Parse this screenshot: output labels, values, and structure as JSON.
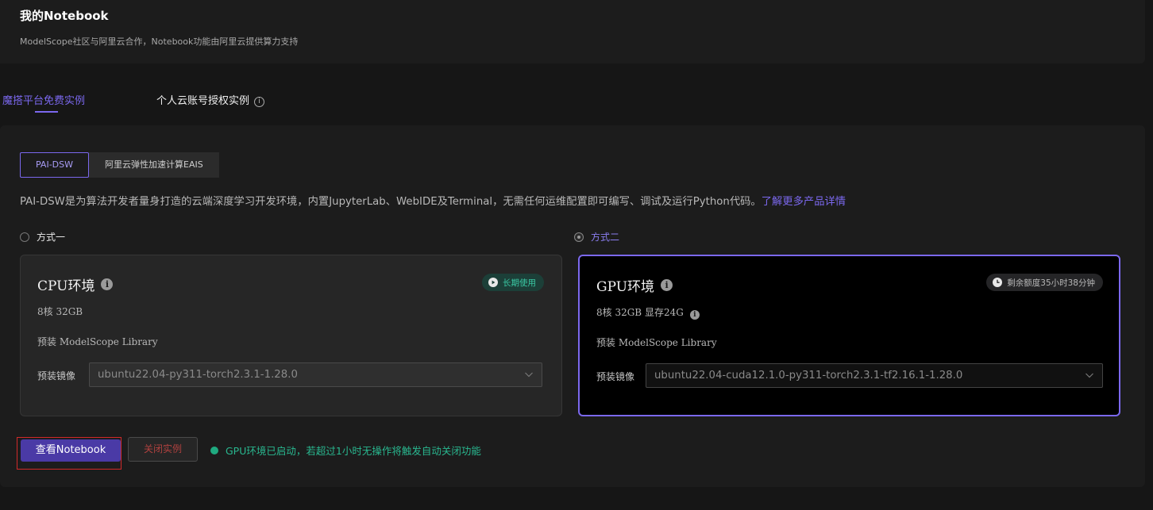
{
  "header": {
    "title": "我的Notebook",
    "subtitle": "ModelScope社区与阿里云合作，Notebook功能由阿里云提供算力支持"
  },
  "tabs": [
    {
      "label": "魔搭平台免费实例",
      "active": true
    },
    {
      "label": "个人云账号授权实例",
      "active": false,
      "icon": "info-circle-icon"
    }
  ],
  "segmented": [
    {
      "label": "PAI-DSW",
      "active": true
    },
    {
      "label": "阿里云弹性加速计算EAIS",
      "active": false
    }
  ],
  "description": {
    "text": "PAI-DSW是为算法开发者量身打造的云端深度学习开发环境，内置JupyterLab、WebIDE及Terminal，无需任何运维配置即可编写、调试及运行Python代码。",
    "link": "了解更多产品详情"
  },
  "options": [
    {
      "radio_label": "方式一",
      "selected": false,
      "title": "CPU环境",
      "badge": "长期使用",
      "spec": "8核 32GB",
      "library": "预装 ModelScope Library",
      "image_label": "预装镜像",
      "image_value": "ubuntu22.04-py311-torch2.3.1-1.28.0"
    },
    {
      "radio_label": "方式二",
      "selected": true,
      "title": "GPU环境",
      "badge": "剩余额度35小时38分钟",
      "spec": "8核 32GB 显存24G",
      "library": "预装 ModelScope Library",
      "image_label": "预装镜像",
      "image_value": "ubuntu22.04-cuda12.1.0-py311-torch2.3.1-tf2.16.1-1.28.0"
    }
  ],
  "actions": {
    "view_label": "查看Notebook",
    "close_label": "关闭实例"
  },
  "status_text": "GPU环境已启动，若超过1小时无操作将触发自动关闭功能",
  "colors": {
    "accent": "#7b68ee",
    "success": "#29b890",
    "danger": "#b0413f",
    "highlight_box": "#d12a2a"
  }
}
